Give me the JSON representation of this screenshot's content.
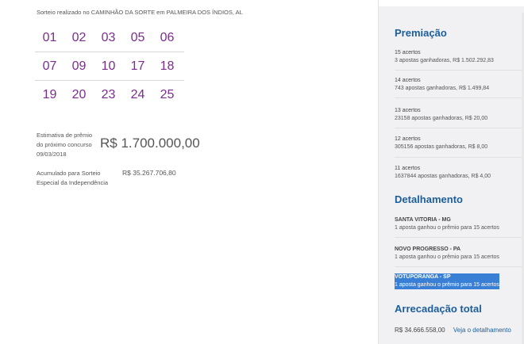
{
  "sorteio_info": "Sorteio realizado no CAMINHÃO DA SORTE em PALMEIRA DOS ÍNDIOS, AL",
  "numbers": [
    [
      "01",
      "02",
      "03",
      "05",
      "06"
    ],
    [
      "07",
      "09",
      "10",
      "17",
      "18"
    ],
    [
      "19",
      "20",
      "23",
      "24",
      "25"
    ]
  ],
  "estimativa": {
    "label_lines": [
      "Estimativa de prêmio",
      "do próximo concurso",
      "09/03/2018"
    ],
    "value": "R$ 1.700.000,00"
  },
  "acumulado": {
    "label_lines": [
      "Acumulado para Sorteio",
      "Especial da Independência"
    ],
    "value": "R$ 35.267.706,80"
  },
  "premiacao": {
    "title": "Premiação",
    "items": [
      {
        "acertos": "15 acertos",
        "desc": "3 apostas ganhadoras, R$ 1.502.292,83"
      },
      {
        "acertos": "14 acertos",
        "desc": "743 apostas ganhadoras, R$ 1.499,84"
      },
      {
        "acertos": "13 acertos",
        "desc": "23158 apostas ganhadoras, R$ 20,00"
      },
      {
        "acertos": "12 acertos",
        "desc": "305156 apostas ganhadoras, R$ 8,00"
      },
      {
        "acertos": "11 acertos",
        "desc": "1637844 apostas ganhadoras, R$ 4,00"
      }
    ]
  },
  "detalhamento": {
    "title": "Detalhamento",
    "items": [
      {
        "city": "SANTA VITORIA - MG",
        "desc": "1 aposta ganhou o prêmio para 15 acertos"
      },
      {
        "city": "NOVO PROGRESSO - PA",
        "desc": "1 aposta ganhou o prêmio para 15 acertos"
      },
      {
        "city": "VOTUPORANGA - SP",
        "desc": "1 aposta ganhou o prêmio para 15 acertos"
      }
    ]
  },
  "arrecadacao": {
    "title": "Arrecadação total",
    "value": "R$ 34.666.558,00",
    "link": "Veja o detalhamento"
  }
}
